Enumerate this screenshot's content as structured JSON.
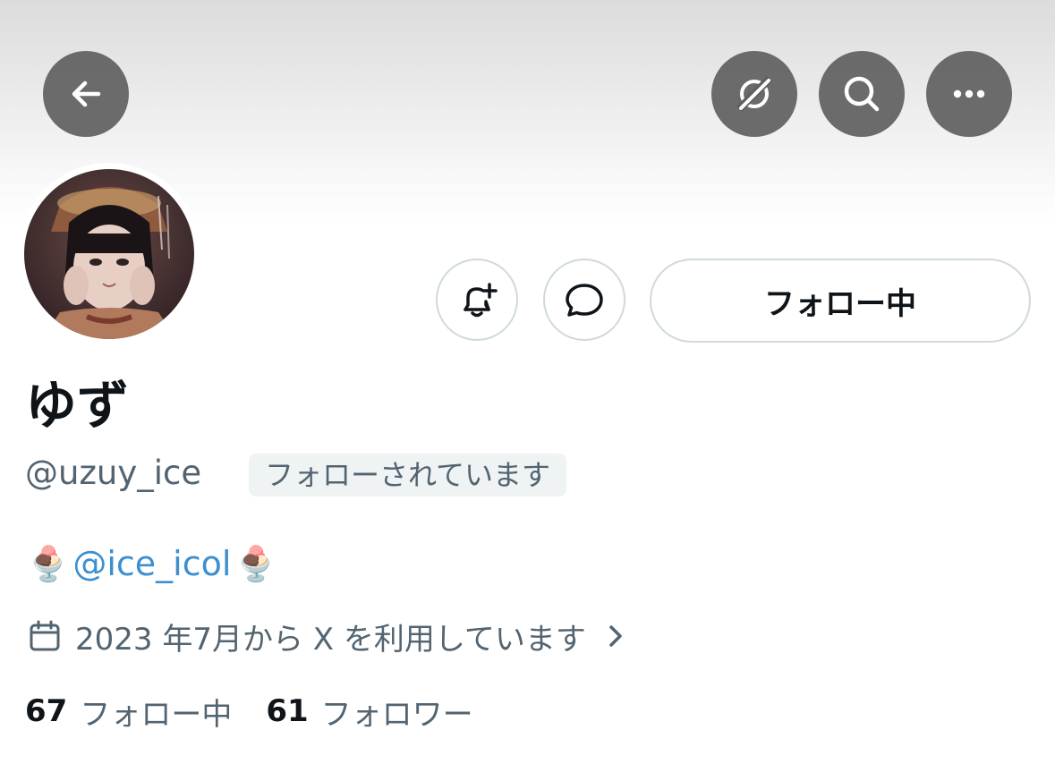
{
  "header": {
    "back_icon": "arrow-left-icon",
    "grok_icon": "grok-icon",
    "search_icon": "search-icon",
    "more_icon": "more-horizontal-icon"
  },
  "profile": {
    "avatar_alt": "profile-photo",
    "display_name": "ゆず",
    "handle": "@uzuy_ice",
    "follows_you_badge": "フォローされています",
    "bio": {
      "emoji_left": "🍨",
      "mention": "@ice_icol",
      "emoji_right": "🍨"
    },
    "joined": "2023 年7月から X を利用しています",
    "following_count": "67",
    "following_label": "フォロー中",
    "followers_count": "61",
    "followers_label": "フォロワー"
  },
  "actions": {
    "notify_icon": "bell-plus-icon",
    "message_icon": "message-bubble-icon",
    "follow_button_label": "フォロー中"
  },
  "colors": {
    "link": "#3d8fcf",
    "secondary_text": "#536471",
    "border": "#cfd9de",
    "badge_bg": "#eff3f4"
  }
}
